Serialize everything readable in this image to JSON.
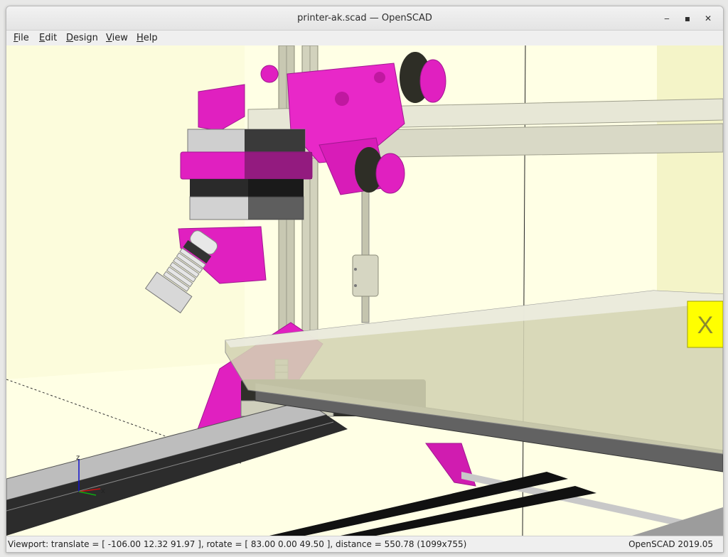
{
  "window": {
    "title": "printer-ak.scad — OpenSCAD",
    "controls": {
      "minimize": "‒",
      "maximize": "▪",
      "close": "✕"
    }
  },
  "menu": {
    "items": [
      {
        "mnemonic": "F",
        "rest": "ile"
      },
      {
        "mnemonic": "E",
        "rest": "dit"
      },
      {
        "mnemonic": "D",
        "rest": "esign"
      },
      {
        "mnemonic": "V",
        "rest": "iew"
      },
      {
        "mnemonic": "H",
        "rest": "elp"
      }
    ]
  },
  "viewport": {
    "background": "#ffffe5",
    "part_color": "#e020c0",
    "axis_label_z": "z",
    "axis_label_x": "x",
    "cube_label": "X"
  },
  "status": {
    "left": "Viewport: translate = [ -106.00 12.32 91.97 ], rotate = [ 83.00 0.00 49.50 ], distance = 550.78 (1099x755)",
    "right": "OpenSCAD 2019.05"
  }
}
